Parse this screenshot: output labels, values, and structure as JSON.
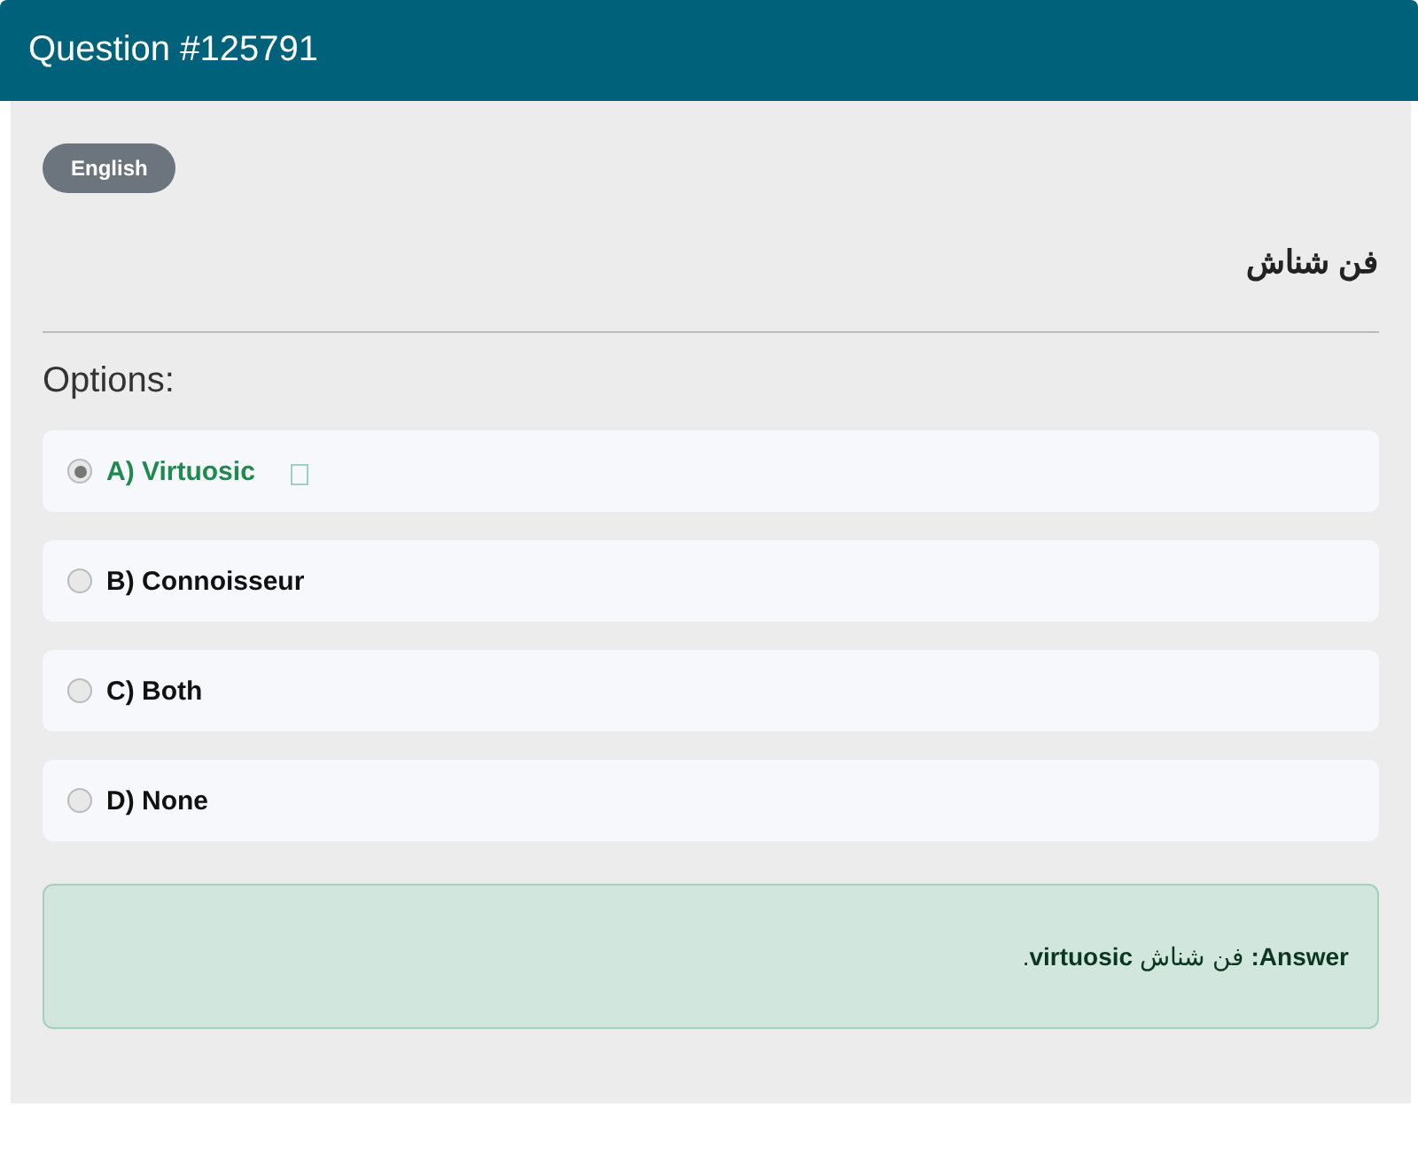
{
  "header": {
    "title": "Question #125791"
  },
  "language_badge": "English",
  "question": "فن شناش",
  "options_label": "Options:",
  "options": [
    {
      "label": "A) Virtuosic",
      "selected": true,
      "correct": true
    },
    {
      "label": "B) Connoisseur",
      "selected": false,
      "correct": false
    },
    {
      "label": "C) Both",
      "selected": false,
      "correct": false
    },
    {
      "label": "D) None",
      "selected": false,
      "correct": false
    }
  ],
  "answer": "**Answer:** فن شناش **virtuosic**."
}
